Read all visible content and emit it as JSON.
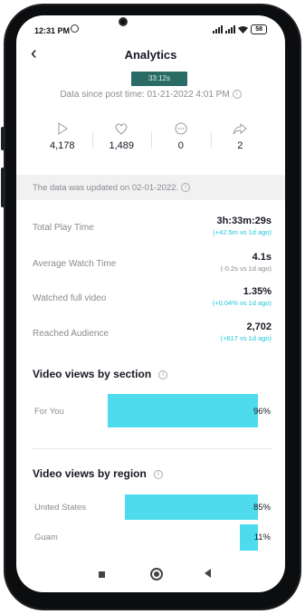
{
  "status_bar": {
    "time": "12:31 PM",
    "battery": "58"
  },
  "header": {
    "back_icon": "chevron-left-icon",
    "title": "Analytics"
  },
  "video": {
    "thumbnail_text": "33:12s"
  },
  "since": {
    "text": "Data since post time: 01-21-2022 4:01 PM"
  },
  "stats": [
    {
      "icon": "play-icon",
      "value": "4,178"
    },
    {
      "icon": "heart-icon",
      "value": "1,489"
    },
    {
      "icon": "comment-icon",
      "value": "0"
    },
    {
      "icon": "share-icon",
      "value": "2"
    }
  ],
  "notice": {
    "text": "The data was updated on 02-01-2022."
  },
  "metrics": [
    {
      "label": "Total Play Time",
      "value": "3h:33m:29s",
      "delta": "(+42.5m vs 1d ago)",
      "delta_color": "#21c6d8"
    },
    {
      "label": "Average Watch Time",
      "value": "4.1s",
      "delta": "(-0.2s vs 1d ago)",
      "delta_color": "#8a8b91"
    },
    {
      "label": "Watched full video",
      "value": "1.35%",
      "delta": "(+0.04% vs 1d ago)",
      "delta_color": "#21c6d8"
    },
    {
      "label": "Reached Audience",
      "value": "2,702",
      "delta": "(+617 vs 1d ago)",
      "delta_color": "#21c6d8"
    }
  ],
  "views_by_section": {
    "title": "Video views by section",
    "rows": [
      {
        "label": "For You",
        "percent": 96,
        "percent_label": "96%"
      }
    ]
  },
  "views_by_region": {
    "title": "Video views by region",
    "rows": [
      {
        "label": "United States",
        "percent": 85,
        "percent_label": "85%"
      },
      {
        "label": "Guam",
        "percent": 11,
        "percent_label": "11%"
      }
    ]
  },
  "colors": {
    "bar": "#4fdbee",
    "accent": "#21c6d8"
  }
}
